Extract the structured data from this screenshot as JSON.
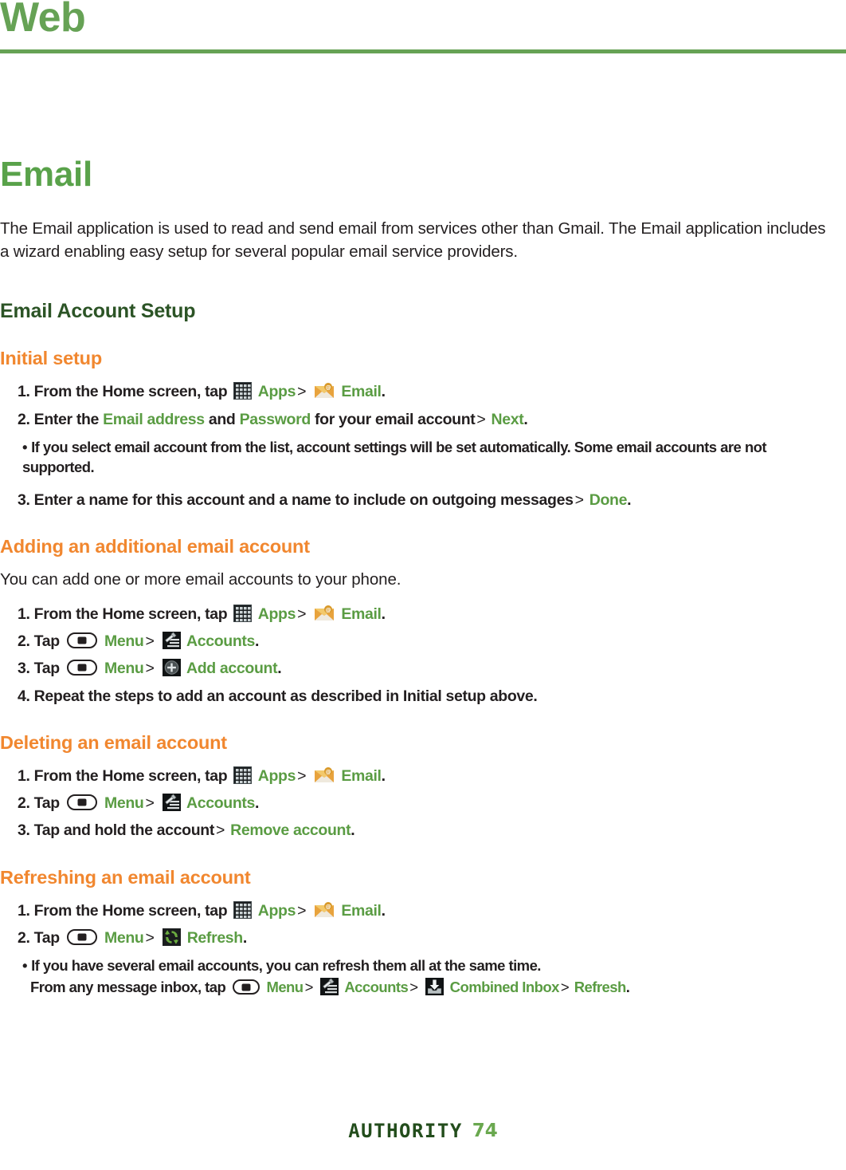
{
  "running_head": {
    "title": "Web"
  },
  "doc": {
    "title": "Email",
    "intro": "The Email application is used to read and send email from services other than Gmail. The Email application includes a wizard enabling easy setup for several popular email service providers.",
    "section_title": "Email Account Setup"
  },
  "colors": {
    "green_heading": "#59a24a",
    "dark_green_heading": "#2c5426",
    "orange_heading": "#f1872f",
    "green_link": "#5a9c43",
    "rule": "#66a255",
    "body_text": "#231f20",
    "page_number": "#6aa84f",
    "brand": "#234d1c"
  },
  "icons": {
    "apps": "apps-grid-icon",
    "email": "email-envelope-icon",
    "menu": "menu-hardkey-icon",
    "accounts": "accounts-icon",
    "add_account": "add-account-plus-icon",
    "refresh": "refresh-icon",
    "combined_inbox": "combined-inbox-icon"
  },
  "sections": {
    "initial_setup": {
      "heading": "Initial setup",
      "step1": {
        "num": "1.",
        "pre": "From the Home screen, tap",
        "apps_label": "Apps",
        "gt": ">",
        "email_label": "Email",
        "period": "."
      },
      "step2": {
        "num": "2.",
        "pre": "Enter the",
        "email_address": "Email address",
        "and": "and",
        "password": "Password",
        "mid": "for your email account",
        "gt": ">",
        "next": "Next",
        "period": "."
      },
      "note": {
        "bullet": "•",
        "text": "If you select email account from the list, account settings will be set automatically. Some email accounts are not supported."
      },
      "step3": {
        "num": "3.",
        "pre": "Enter a name for this account and a name to include on outgoing messages",
        "gt": ">",
        "done": "Done",
        "period": "."
      }
    },
    "adding_account": {
      "heading": "Adding an additional email account",
      "lead": "You can add one or more email accounts to your phone.",
      "step1": {
        "num": "1.",
        "pre": "From the Home screen, tap",
        "apps_label": "Apps",
        "gt": ">",
        "email_label": "Email",
        "period": "."
      },
      "step2": {
        "num": "2.",
        "pre": "Tap",
        "menu_label": "Menu",
        "gt": ">",
        "accounts_label": "Accounts",
        "period": "."
      },
      "step3": {
        "num": "3.",
        "pre": "Tap",
        "menu_label": "Menu",
        "gt": ">",
        "add_label": "Add account",
        "period": "."
      },
      "step4": {
        "num": "4.",
        "text": "Repeat the steps to add an account as described in Initial setup above."
      }
    },
    "deleting_account": {
      "heading": "Deleting an email account",
      "step1": {
        "num": "1.",
        "pre": "From the Home screen, tap",
        "apps_label": "Apps",
        "gt": ">",
        "email_label": "Email",
        "period": "."
      },
      "step2": {
        "num": "2.",
        "pre": "Tap",
        "menu_label": "Menu",
        "gt": ">",
        "accounts_label": "Accounts",
        "period": "."
      },
      "step3": {
        "num": "3.",
        "pre": "Tap and hold the account",
        "gt": ">",
        "remove_label": "Remove account",
        "period": "."
      }
    },
    "refreshing_account": {
      "heading": "Refreshing an email account",
      "step1": {
        "num": "1.",
        "pre": "From the Home screen, tap",
        "apps_label": "Apps",
        "gt": ">",
        "email_label": "Email",
        "period": "."
      },
      "step2": {
        "num": "2.",
        "pre": "Tap",
        "menu_label": "Menu",
        "gt": ">",
        "refresh_label": "Refresh",
        "period": "."
      },
      "note": {
        "bullet": "•",
        "line1": "If you have several email accounts, you can refresh them all at the same time.",
        "line2_pre": "From any message inbox, tap",
        "menu_label": "Menu",
        "gt1": ">",
        "accounts_label": "Accounts",
        "gt2": ">",
        "combined_label": "Combined Inbox",
        "gt3": ">",
        "refresh_label": "Refresh",
        "period": "."
      }
    }
  },
  "footer": {
    "brand": "AUTHORITY",
    "page_number": "74"
  }
}
